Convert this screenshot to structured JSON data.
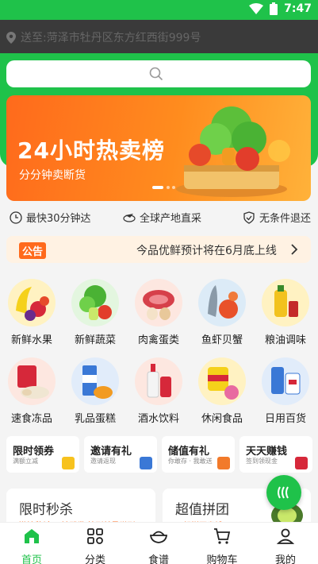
{
  "status": {
    "time": "7:47"
  },
  "header": {
    "address": "送至:菏泽市牡丹区东方红西街999号"
  },
  "search": {
    "placeholder": ""
  },
  "banner": {
    "title": "24小时热卖榜",
    "subtitle": "分分钟卖断货"
  },
  "features": [
    "最快30分钟达",
    "全球产地直采",
    "无条件退还"
  ],
  "notice": {
    "tag": "公告",
    "text": "今品优鲜预计将在6月底上线"
  },
  "categories": [
    {
      "label": "新鲜水果"
    },
    {
      "label": "新鲜蔬菜"
    },
    {
      "label": "肉禽蛋类"
    },
    {
      "label": "鱼虾贝蟹"
    },
    {
      "label": "粮油调味"
    },
    {
      "label": "速食冻品"
    },
    {
      "label": "乳品蛋糕"
    },
    {
      "label": "酒水饮料"
    },
    {
      "label": "休闲食品"
    },
    {
      "label": "日用百货"
    }
  ],
  "promos": [
    {
      "title": "限时领券",
      "sub": "满额立减"
    },
    {
      "title": "邀请有礼",
      "sub": "邀请返现"
    },
    {
      "title": "储值有礼",
      "sub": "你敢存 · 我敢送"
    },
    {
      "title": "天天赚钱",
      "sub": "签到领现金"
    }
  ],
  "cards": [
    {
      "title": "限时秒杀",
      "sub": "激情秒杀 一触即发 抢到就是赚到"
    },
    {
      "title": "超值拼团",
      "sub": "一起拼更省钱"
    }
  ],
  "tabs": [
    {
      "label": "首页"
    },
    {
      "label": "分类"
    },
    {
      "label": "食谱"
    },
    {
      "label": "购物车"
    },
    {
      "label": "我的"
    }
  ],
  "colors": {
    "brand_green": "#1fc24a",
    "accent_orange": "#ff6a1c"
  }
}
